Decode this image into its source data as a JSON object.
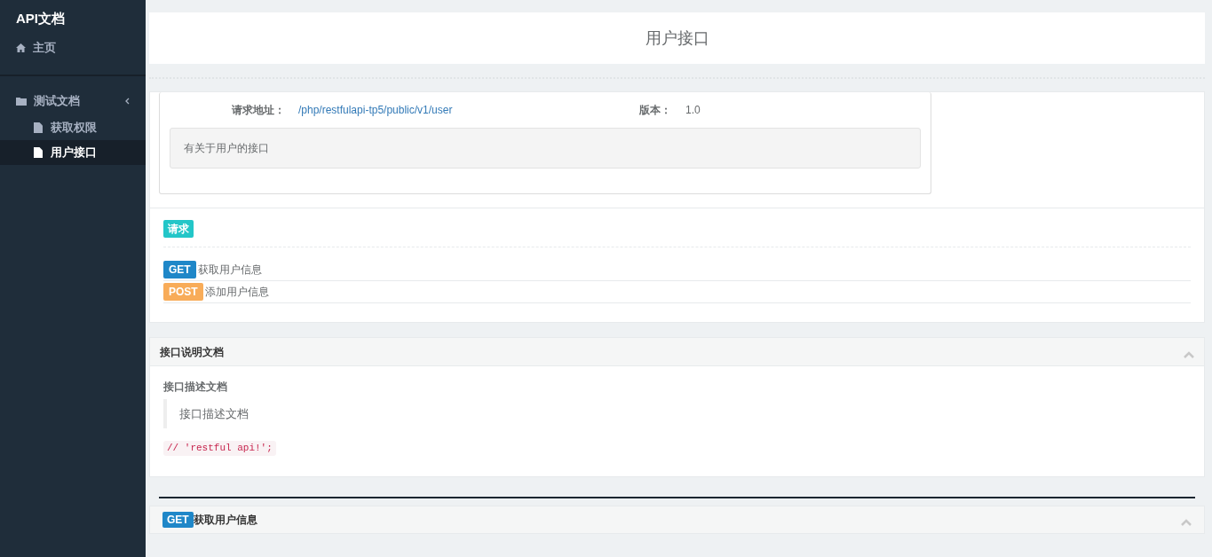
{
  "sidebar": {
    "brand": "API文档",
    "items": [
      {
        "label": "主页",
        "kind": "home",
        "selected": false
      },
      {
        "label": "测试文档",
        "kind": "folder",
        "expanded": true,
        "children": [
          {
            "label": "获取权限",
            "selected": false
          },
          {
            "label": "用户接口",
            "selected": true
          }
        ]
      }
    ]
  },
  "page_title": "用户接口",
  "info": {
    "url_label": "请求地址：",
    "url": "/php/restfulapi-tp5/public/v1/user",
    "version_label": "版本：",
    "version": "1.0",
    "description": "有关于用户的接口"
  },
  "requests": {
    "badge": "请求",
    "items": [
      {
        "method": "GET",
        "label": "获取用户信息"
      },
      {
        "method": "POST",
        "label": "添加用户信息"
      }
    ]
  },
  "doc_panel": {
    "title": "接口说明文档",
    "heading": "接口描述文档",
    "quote": "接口描述文档",
    "code": "// 'restful api!';"
  },
  "method_panel": {
    "method": "GET",
    "title": "获取用户信息"
  }
}
